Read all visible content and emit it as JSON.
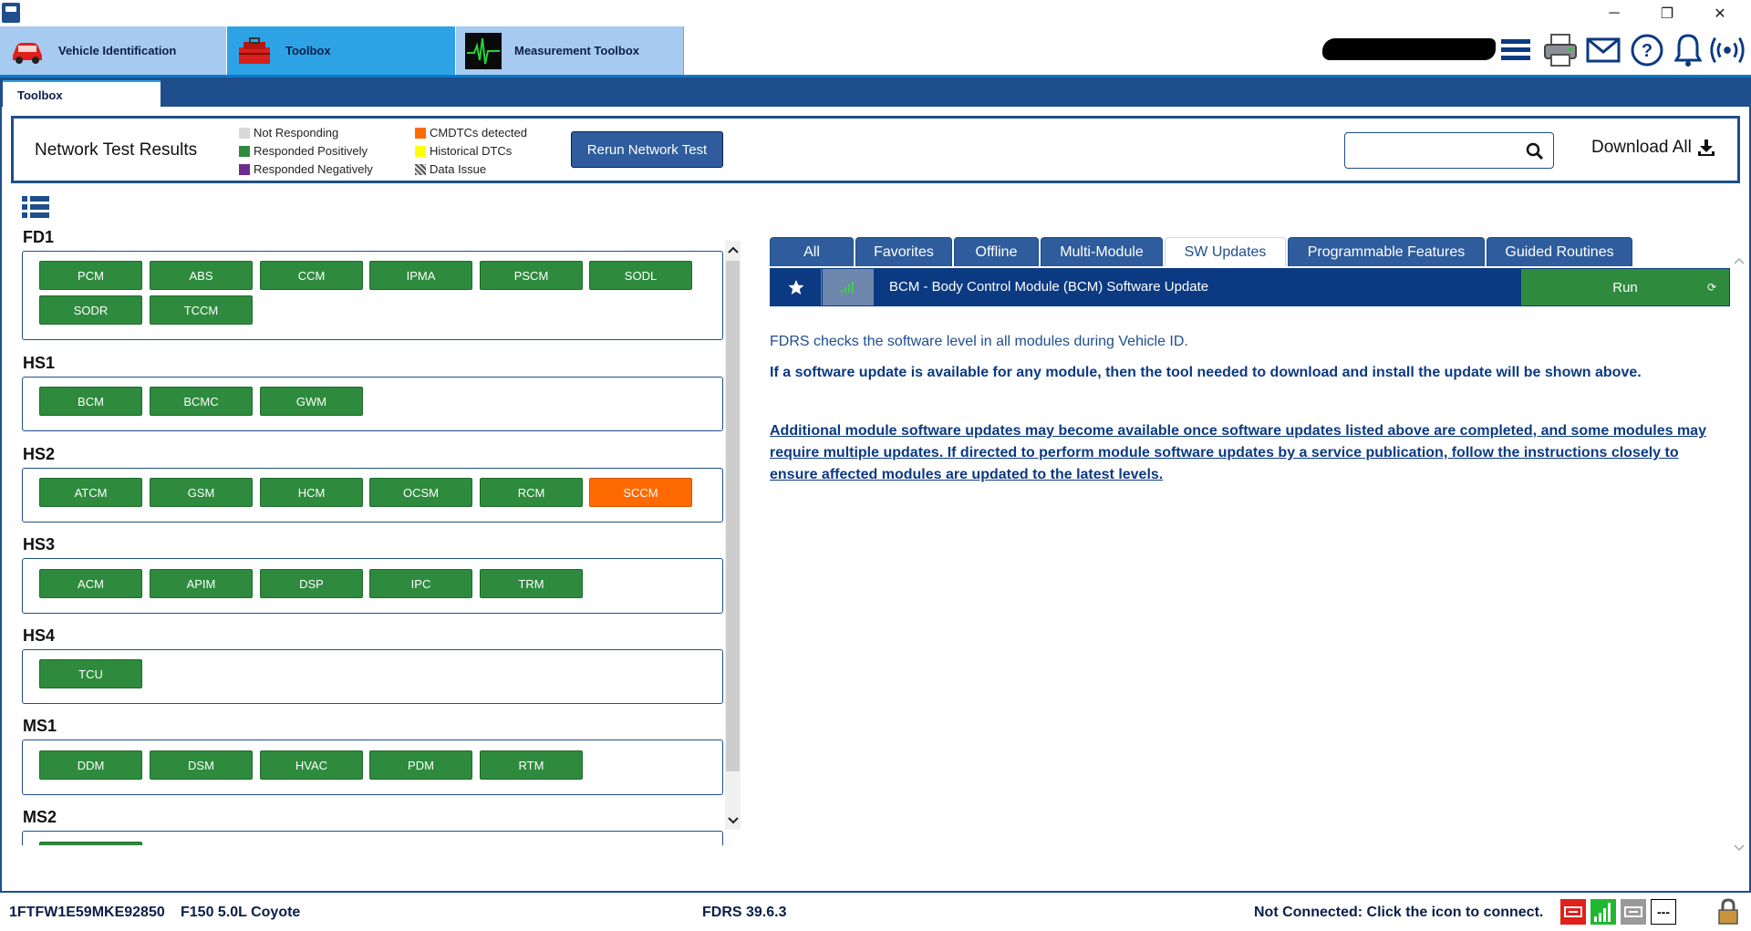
{
  "window": {
    "minimize_glyph": "─",
    "maximize_glyph": "❐",
    "close_glyph": "✕"
  },
  "top_tabs": [
    {
      "label": "Vehicle Identification",
      "icon": "car-icon"
    },
    {
      "label": "Toolbox",
      "icon": "toolbox-icon"
    },
    {
      "label": "Measurement Toolbox",
      "icon": "oscilloscope-icon"
    }
  ],
  "sub_tab": {
    "label": "Toolbox"
  },
  "network_test": {
    "title": "Network Test Results",
    "legend": [
      {
        "label": "Not Responding",
        "color": "#d9d9d9"
      },
      {
        "label": "Responded Positively",
        "color": "#2e8b3e"
      },
      {
        "label": "Responded Negatively",
        "color": "#6b2c91"
      },
      {
        "label": "CMDTCs detected",
        "color": "#ff6a00"
      },
      {
        "label": "Historical DTCs",
        "color": "#ffff00"
      },
      {
        "label": "Data Issue",
        "color": "hatched"
      }
    ],
    "rerun_label": "Rerun Network Test",
    "search_placeholder": "",
    "download_label": "Download All"
  },
  "groups": [
    {
      "name": "FD1",
      "modules": [
        {
          "label": "PCM",
          "state": "positive"
        },
        {
          "label": "ABS",
          "state": "positive"
        },
        {
          "label": "CCM",
          "state": "positive"
        },
        {
          "label": "IPMA",
          "state": "positive"
        },
        {
          "label": "PSCM",
          "state": "positive"
        },
        {
          "label": "SODL",
          "state": "positive"
        },
        {
          "label": "SODR",
          "state": "positive"
        },
        {
          "label": "TCCM",
          "state": "positive"
        }
      ]
    },
    {
      "name": "HS1",
      "modules": [
        {
          "label": "BCM",
          "state": "positive"
        },
        {
          "label": "BCMC",
          "state": "positive"
        },
        {
          "label": "GWM",
          "state": "positive"
        }
      ]
    },
    {
      "name": "HS2",
      "modules": [
        {
          "label": "ATCM",
          "state": "positive"
        },
        {
          "label": "GSM",
          "state": "positive"
        },
        {
          "label": "HCM",
          "state": "positive"
        },
        {
          "label": "OCSM",
          "state": "positive"
        },
        {
          "label": "RCM",
          "state": "positive"
        },
        {
          "label": "SCCM",
          "state": "cmdtc"
        }
      ]
    },
    {
      "name": "HS3",
      "modules": [
        {
          "label": "ACM",
          "state": "positive"
        },
        {
          "label": "APIM",
          "state": "positive"
        },
        {
          "label": "DSP",
          "state": "positive"
        },
        {
          "label": "IPC",
          "state": "positive"
        },
        {
          "label": "TRM",
          "state": "positive"
        }
      ]
    },
    {
      "name": "HS4",
      "modules": [
        {
          "label": "TCU",
          "state": "positive"
        }
      ]
    },
    {
      "name": "MS1",
      "modules": [
        {
          "label": "DDM",
          "state": "positive"
        },
        {
          "label": "DSM",
          "state": "positive"
        },
        {
          "label": "HVAC",
          "state": "positive"
        },
        {
          "label": "PDM",
          "state": "positive"
        },
        {
          "label": "RTM",
          "state": "positive"
        }
      ]
    },
    {
      "name": "MS2",
      "modules": [
        {
          "label": "",
          "state": "positive"
        }
      ]
    }
  ],
  "right_tabs": [
    {
      "label": "All",
      "active": false
    },
    {
      "label": "Favorites",
      "active": false
    },
    {
      "label": "Offline",
      "active": false
    },
    {
      "label": "Multi-Module",
      "active": false
    },
    {
      "label": "SW Updates",
      "active": true
    },
    {
      "label": "Programmable Features",
      "active": false
    },
    {
      "label": "Guided Routines",
      "active": false
    }
  ],
  "tool_row": {
    "name": "BCM - Body Control Module (BCM) Software Update",
    "run_label": "Run",
    "refresh_glyph": "⟳"
  },
  "info": {
    "line1": "FDRS checks the software level in all modules during Vehicle ID.",
    "line2": "If a software update is available for any module, then the tool needed to download and install the update will be shown above.",
    "line3": "Additional module software updates may become available once software updates listed above are completed, and some modules may require multiple updates. If directed to perform module software updates by a service publication, follow the instructions closely to ensure affected modules are updated to the latest levels."
  },
  "status": {
    "vin": "1FTFW1E59MKE92850",
    "vehicle": "F150 5.0L Coyote",
    "version": "FDRS 39.6.3",
    "connection": "Not Connected: Click the icon to connect.",
    "vci_dashes": "---"
  }
}
